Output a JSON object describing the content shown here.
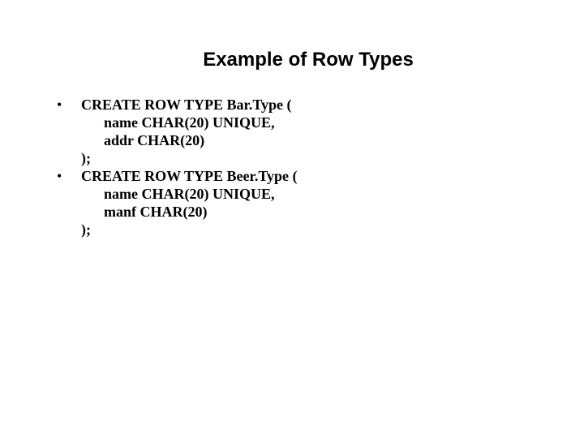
{
  "title": "Example of Row Types",
  "items": [
    {
      "lines": [
        "CREATE ROW TYPE Bar.Type (",
        "name CHAR(20) UNIQUE,",
        "addr CHAR(20)",
        ");"
      ]
    },
    {
      "lines": [
        "CREATE ROW TYPE Beer.Type (",
        "name CHAR(20) UNIQUE,",
        "manf CHAR(20)",
        ");"
      ]
    }
  ],
  "bullet_char": "•"
}
